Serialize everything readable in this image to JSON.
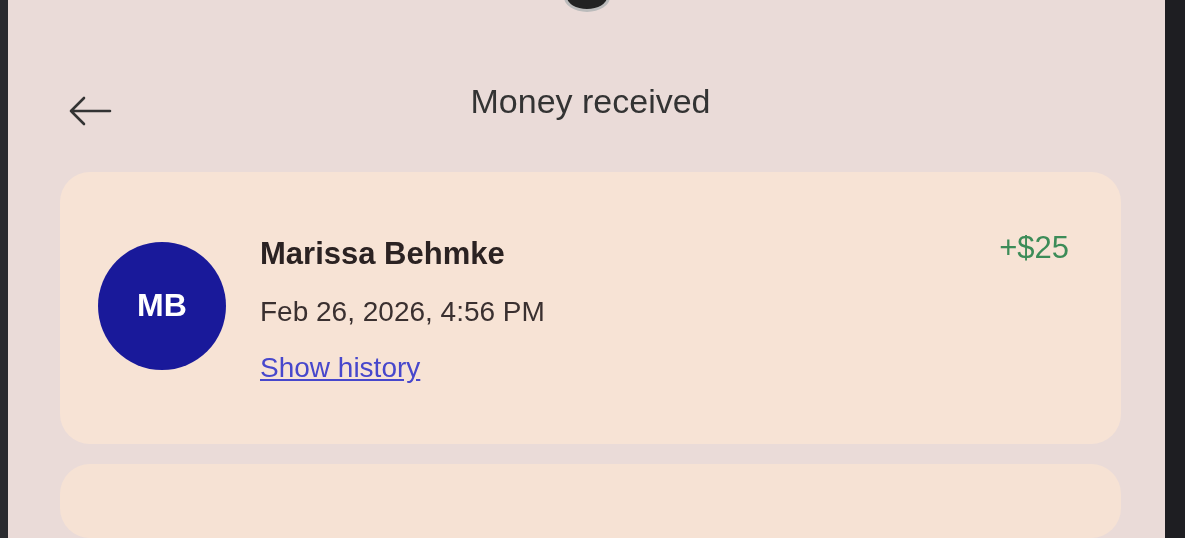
{
  "header": {
    "title": "Money received"
  },
  "transactions": [
    {
      "initials": "MB",
      "name": "Marissa Behmke",
      "datetime": "Feb 26, 2026, 4:56 PM",
      "link": "Show history",
      "amount": "+$25"
    }
  ]
}
